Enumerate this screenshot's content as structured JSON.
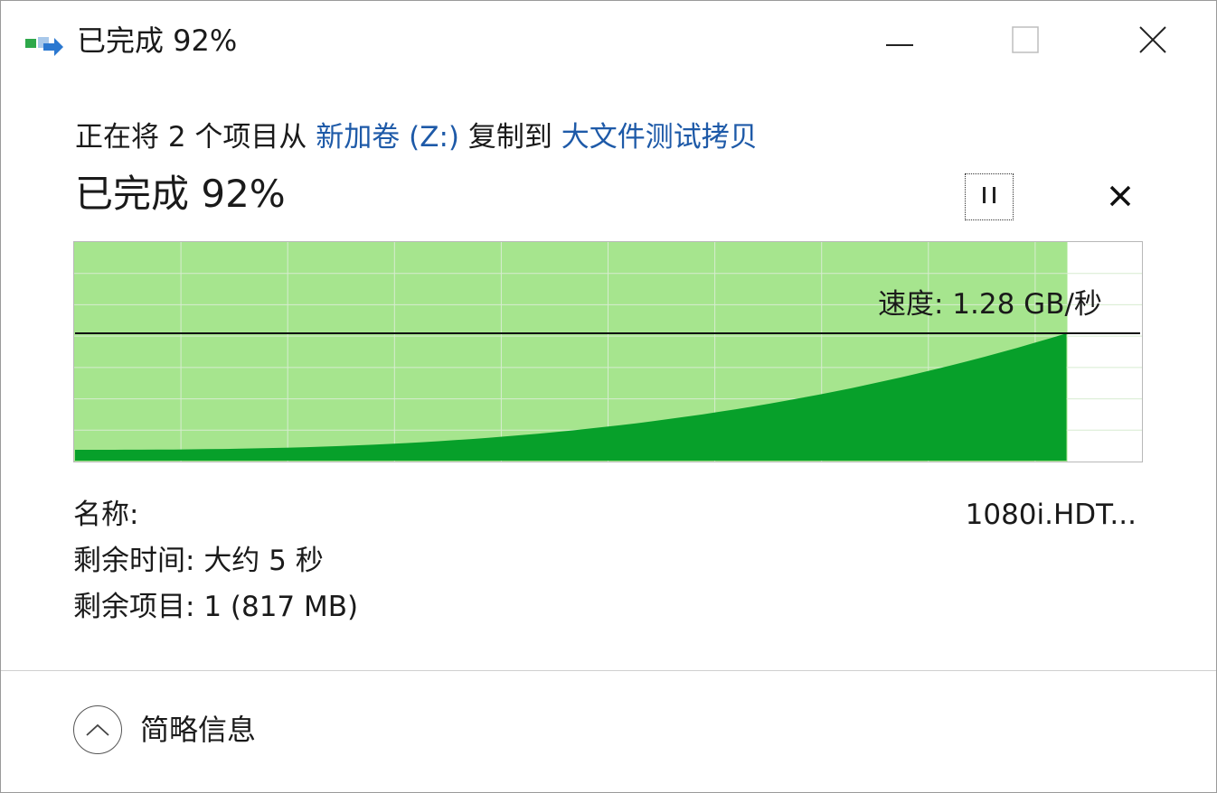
{
  "window": {
    "title": "已完成 92%"
  },
  "icons": {
    "app": "copy-progress-icon",
    "minimize": "minimize-icon",
    "maximize": "maximize-icon",
    "close": "close-icon",
    "pause": "pause-icon",
    "cancel": "cancel-icon",
    "collapse": "chevron-up-icon"
  },
  "copy": {
    "prefix": "正在将 2 个项目从 ",
    "source": "新加卷 (Z:)",
    "middle": " 复制到 ",
    "destination": "大文件测试拷贝"
  },
  "status": {
    "percent_text": "已完成 92%",
    "progress": 0.92
  },
  "graph": {
    "speed_text": "速度: 1.28 GB/秒",
    "fill_color": "#a6e58e",
    "speed_color": "#07a02a",
    "current_speed_level": 0.58
  },
  "details": {
    "name_label": "名称:",
    "name_value": "1080i.HDT...",
    "time_label": "剩余时间: ",
    "time_value": "大约 5 秒",
    "items_label": "剩余项目: ",
    "items_value": "1 (817 MB)"
  },
  "footer": {
    "less_details_label": "简略信息"
  }
}
